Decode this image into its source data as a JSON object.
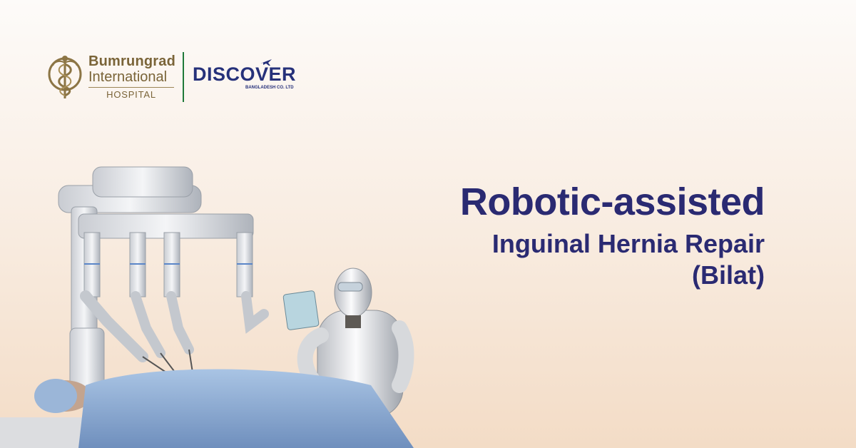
{
  "branding": {
    "hospital_line1": "Bumrungrad",
    "hospital_line2": "International",
    "hospital_line3": "HOSPITAL",
    "partner_name": "DISCOVER",
    "partner_subtitle": "BANGLADESH CO. LTD"
  },
  "headline": {
    "line1": "Robotic-assisted",
    "line2": "Inguinal Hernia Repair",
    "line3": "(Bilat)"
  },
  "colors": {
    "headline": "#2a2a72",
    "hospital_gold": "#7a6438",
    "partner_blue": "#26317a",
    "divider_green": "#1f7a3a",
    "background_top": "#fdfbf9",
    "background_bottom": "#f3dcc6"
  },
  "icons": {
    "hospital_emblem": "caduceus-emblem-icon",
    "partner_plane": "airplane-icon"
  }
}
